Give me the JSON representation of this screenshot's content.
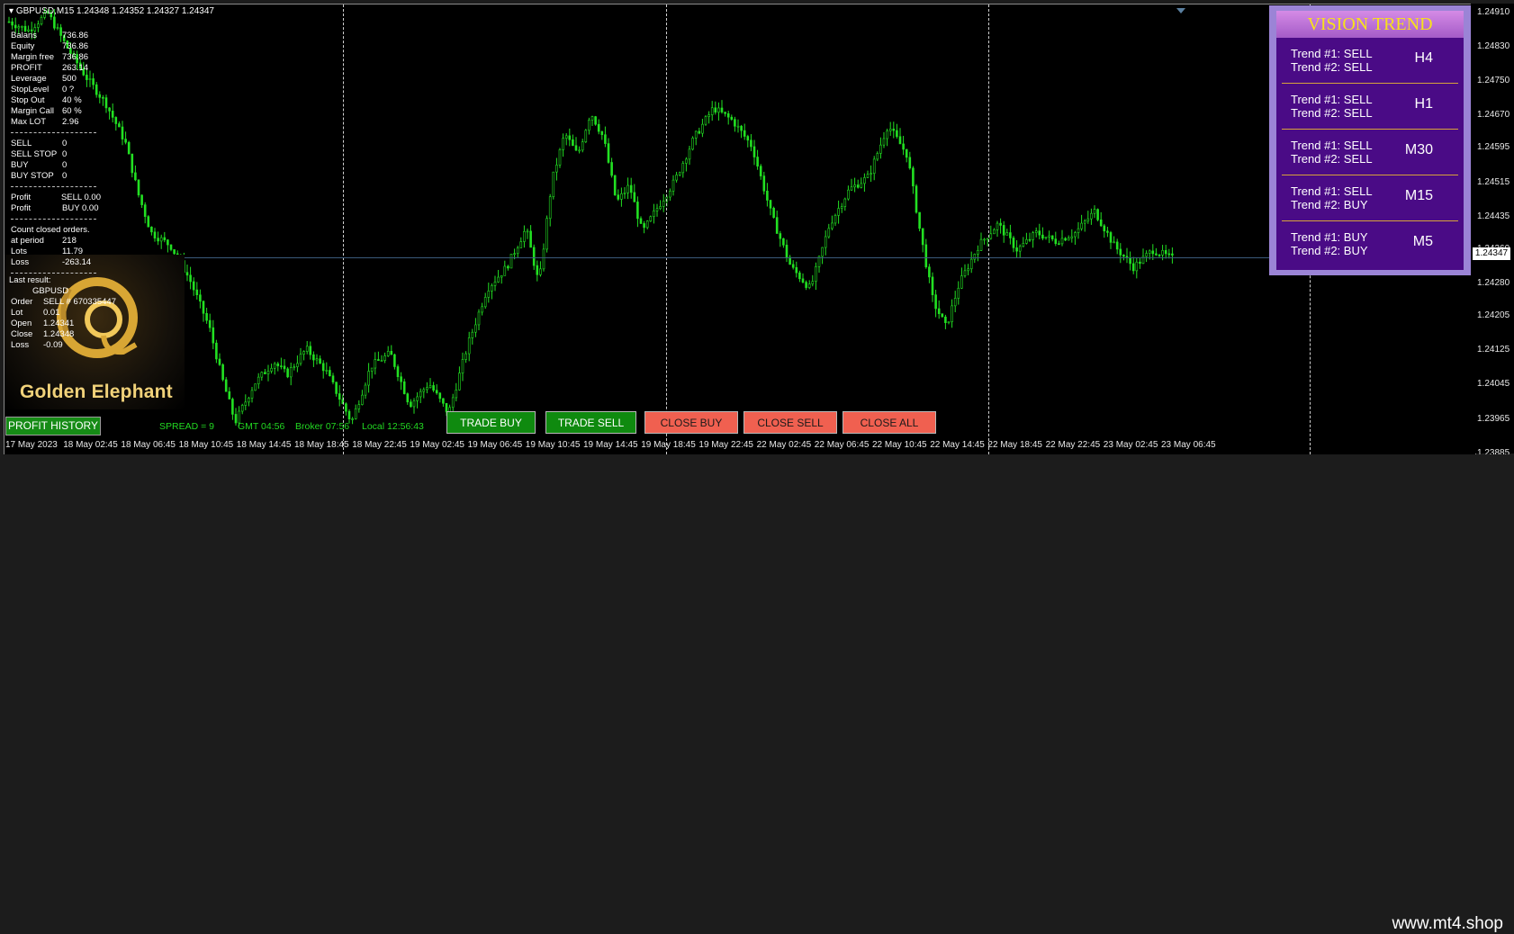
{
  "header": {
    "symbol_line": "GBPUSD,M15  1.24348 1.24352 1.24327 1.24347"
  },
  "account_info": [
    {
      "k": "Balans",
      "v": "736.86"
    },
    {
      "k": "Equity",
      "v": "736.86"
    },
    {
      "k": "Margin free",
      "v": "736.86"
    },
    {
      "k": "PROFIT",
      "v": "263.14"
    },
    {
      "k": "Leverage",
      "v": "500"
    },
    {
      "k": "StopLevel",
      "v": "0 ?"
    },
    {
      "k": "Stop Out",
      "v": "40 %"
    },
    {
      "k": "Margin Call",
      "v": "60 %"
    },
    {
      "k": "Max LOT",
      "v": "2.96"
    }
  ],
  "orders_info": [
    {
      "k": "SELL",
      "v": "0"
    },
    {
      "k": "SELL STOP",
      "v": "0"
    },
    {
      "k": "BUY",
      "v": "0"
    },
    {
      "k": "BUY STOP",
      "v": "0"
    }
  ],
  "profit_info": [
    {
      "k": "Profit",
      "v": "SELL   0.00"
    },
    {
      "k": "Profit",
      "v": "BUY   0.00"
    }
  ],
  "closed_info": {
    "title": "Count closed orders.",
    "rows": [
      {
        "k": "at period",
        "v": "218"
      },
      {
        "k": "Lots",
        "v": "11.79"
      },
      {
        "k": "Loss",
        "v": "-263.14"
      }
    ]
  },
  "last_result": {
    "title": "Last result:",
    "symbol": "GBPUSD",
    "rows": [
      {
        "k": "Order",
        "v": "SELL  # 670335447"
      },
      {
        "k": "Lot",
        "v": "0.01"
      },
      {
        "k": "Open",
        "v": "1.24341"
      },
      {
        "k": "Close",
        "v": "1.24348"
      },
      {
        "k": "Loss",
        "v": "-0.09"
      }
    ]
  },
  "logo_text": "Golden Elephant",
  "profit_history_label": "PROFIT HISTORY",
  "status": {
    "spread": "SPREAD = 9",
    "gmt": "GMT 04:56",
    "broker": "Broker 07:56",
    "local": "Local 12:56:43"
  },
  "buttons": {
    "trade_buy": "TRADE BUY",
    "trade_sell": "TRADE SELL",
    "close_buy": "CLOSE BUY",
    "close_sell": "CLOSE SELL",
    "close_all": "CLOSE ALL"
  },
  "vision_trend": {
    "title": "VISION TREND",
    "rows": [
      {
        "t1": "Trend #1: SELL",
        "t2": "Trend #2: SELL",
        "tf": "H4"
      },
      {
        "t1": "Trend #1: SELL",
        "t2": "Trend #2: SELL",
        "tf": "H1"
      },
      {
        "t1": "Trend #1: SELL",
        "t2": "Trend #2: SELL",
        "tf": "M30"
      },
      {
        "t1": "Trend #1: SELL",
        "t2": "Trend #2: BUY",
        "tf": "M15"
      },
      {
        "t1": "Trend #1: BUY",
        "t2": "Trend #2: BUY",
        "tf": "M5"
      }
    ]
  },
  "current_price_tag": "1.24347",
  "watermark": "www.mt4.shop",
  "colors": {
    "candle": "#22e022",
    "background": "#000000",
    "buy_button": "#0f8a0f",
    "close_button": "#f06050"
  },
  "chart_data": {
    "type": "candlestick",
    "y_ticks": [
      "1.24910",
      "1.24830",
      "1.24750",
      "1.24670",
      "1.24595",
      "1.24515",
      "1.24435",
      "1.24360",
      "1.24280",
      "1.24205",
      "1.24125",
      "1.24045",
      "1.23965",
      "1.23885"
    ],
    "x_ticks": [
      "17 May 2023",
      "18 May 02:45",
      "18 May 06:45",
      "18 May 10:45",
      "18 May 14:45",
      "18 May 18:45",
      "18 May 22:45",
      "19 May 02:45",
      "19 May 06:45",
      "19 May 10:45",
      "19 May 14:45",
      "19 May 18:45",
      "19 May 22:45",
      "22 May 02:45",
      "22 May 06:45",
      "22 May 10:45",
      "22 May 14:45",
      "22 May 18:45",
      "22 May 22:45",
      "23 May 02:45",
      "23 May 06:45"
    ],
    "ylim": [
      1.23885,
      1.2493
    ],
    "last_price": 1.24347,
    "close_path": [
      [
        0,
        1.2489
      ],
      [
        3,
        1.2487
      ],
      [
        6,
        1.2491
      ],
      [
        9,
        1.2483
      ],
      [
        12,
        1.2476
      ],
      [
        15,
        1.247
      ],
      [
        18,
        1.2461
      ],
      [
        20,
        1.2449
      ],
      [
        22,
        1.244
      ],
      [
        25,
        1.2437
      ],
      [
        28,
        1.2429
      ],
      [
        31,
        1.2418
      ],
      [
        33,
        1.2406
      ],
      [
        35,
        1.2396
      ],
      [
        38,
        1.2405
      ],
      [
        41,
        1.241
      ],
      [
        43,
        1.2407
      ],
      [
        46,
        1.2413
      ],
      [
        49,
        1.2408
      ],
      [
        51,
        1.2402
      ],
      [
        53,
        1.2396
      ],
      [
        56,
        1.2409
      ],
      [
        59,
        1.2412
      ],
      [
        62,
        1.24
      ],
      [
        65,
        1.2405
      ],
      [
        68,
        1.2398
      ],
      [
        71,
        1.2414
      ],
      [
        74,
        1.2427
      ],
      [
        77,
        1.2432
      ],
      [
        80,
        1.2441
      ],
      [
        82,
        1.2428
      ],
      [
        84,
        1.2452
      ],
      [
        86,
        1.2463
      ],
      [
        88,
        1.2458
      ],
      [
        90,
        1.2468
      ],
      [
        92,
        1.2462
      ],
      [
        94,
        1.2447
      ],
      [
        96,
        1.2451
      ],
      [
        98,
        1.244
      ],
      [
        100,
        1.2445
      ],
      [
        103,
        1.2452
      ],
      [
        106,
        1.2462
      ],
      [
        109,
        1.2469
      ],
      [
        112,
        1.2466
      ],
      [
        115,
        1.246
      ],
      [
        118,
        1.2444
      ],
      [
        121,
        1.2432
      ],
      [
        124,
        1.2427
      ],
      [
        127,
        1.2442
      ],
      [
        130,
        1.245
      ],
      [
        133,
        1.2453
      ],
      [
        136,
        1.2465
      ],
      [
        139,
        1.2458
      ],
      [
        141,
        1.244
      ],
      [
        143,
        1.2424
      ],
      [
        145,
        1.2418
      ],
      [
        147,
        1.2428
      ],
      [
        150,
        1.2437
      ],
      [
        153,
        1.2442
      ],
      [
        156,
        1.2436
      ],
      [
        159,
        1.244
      ],
      [
        162,
        1.2438
      ],
      [
        165,
        1.244
      ],
      [
        168,
        1.2445
      ],
      [
        171,
        1.2437
      ],
      [
        174,
        1.2432
      ],
      [
        177,
        1.2436
      ],
      [
        180,
        1.2434
      ]
    ]
  }
}
